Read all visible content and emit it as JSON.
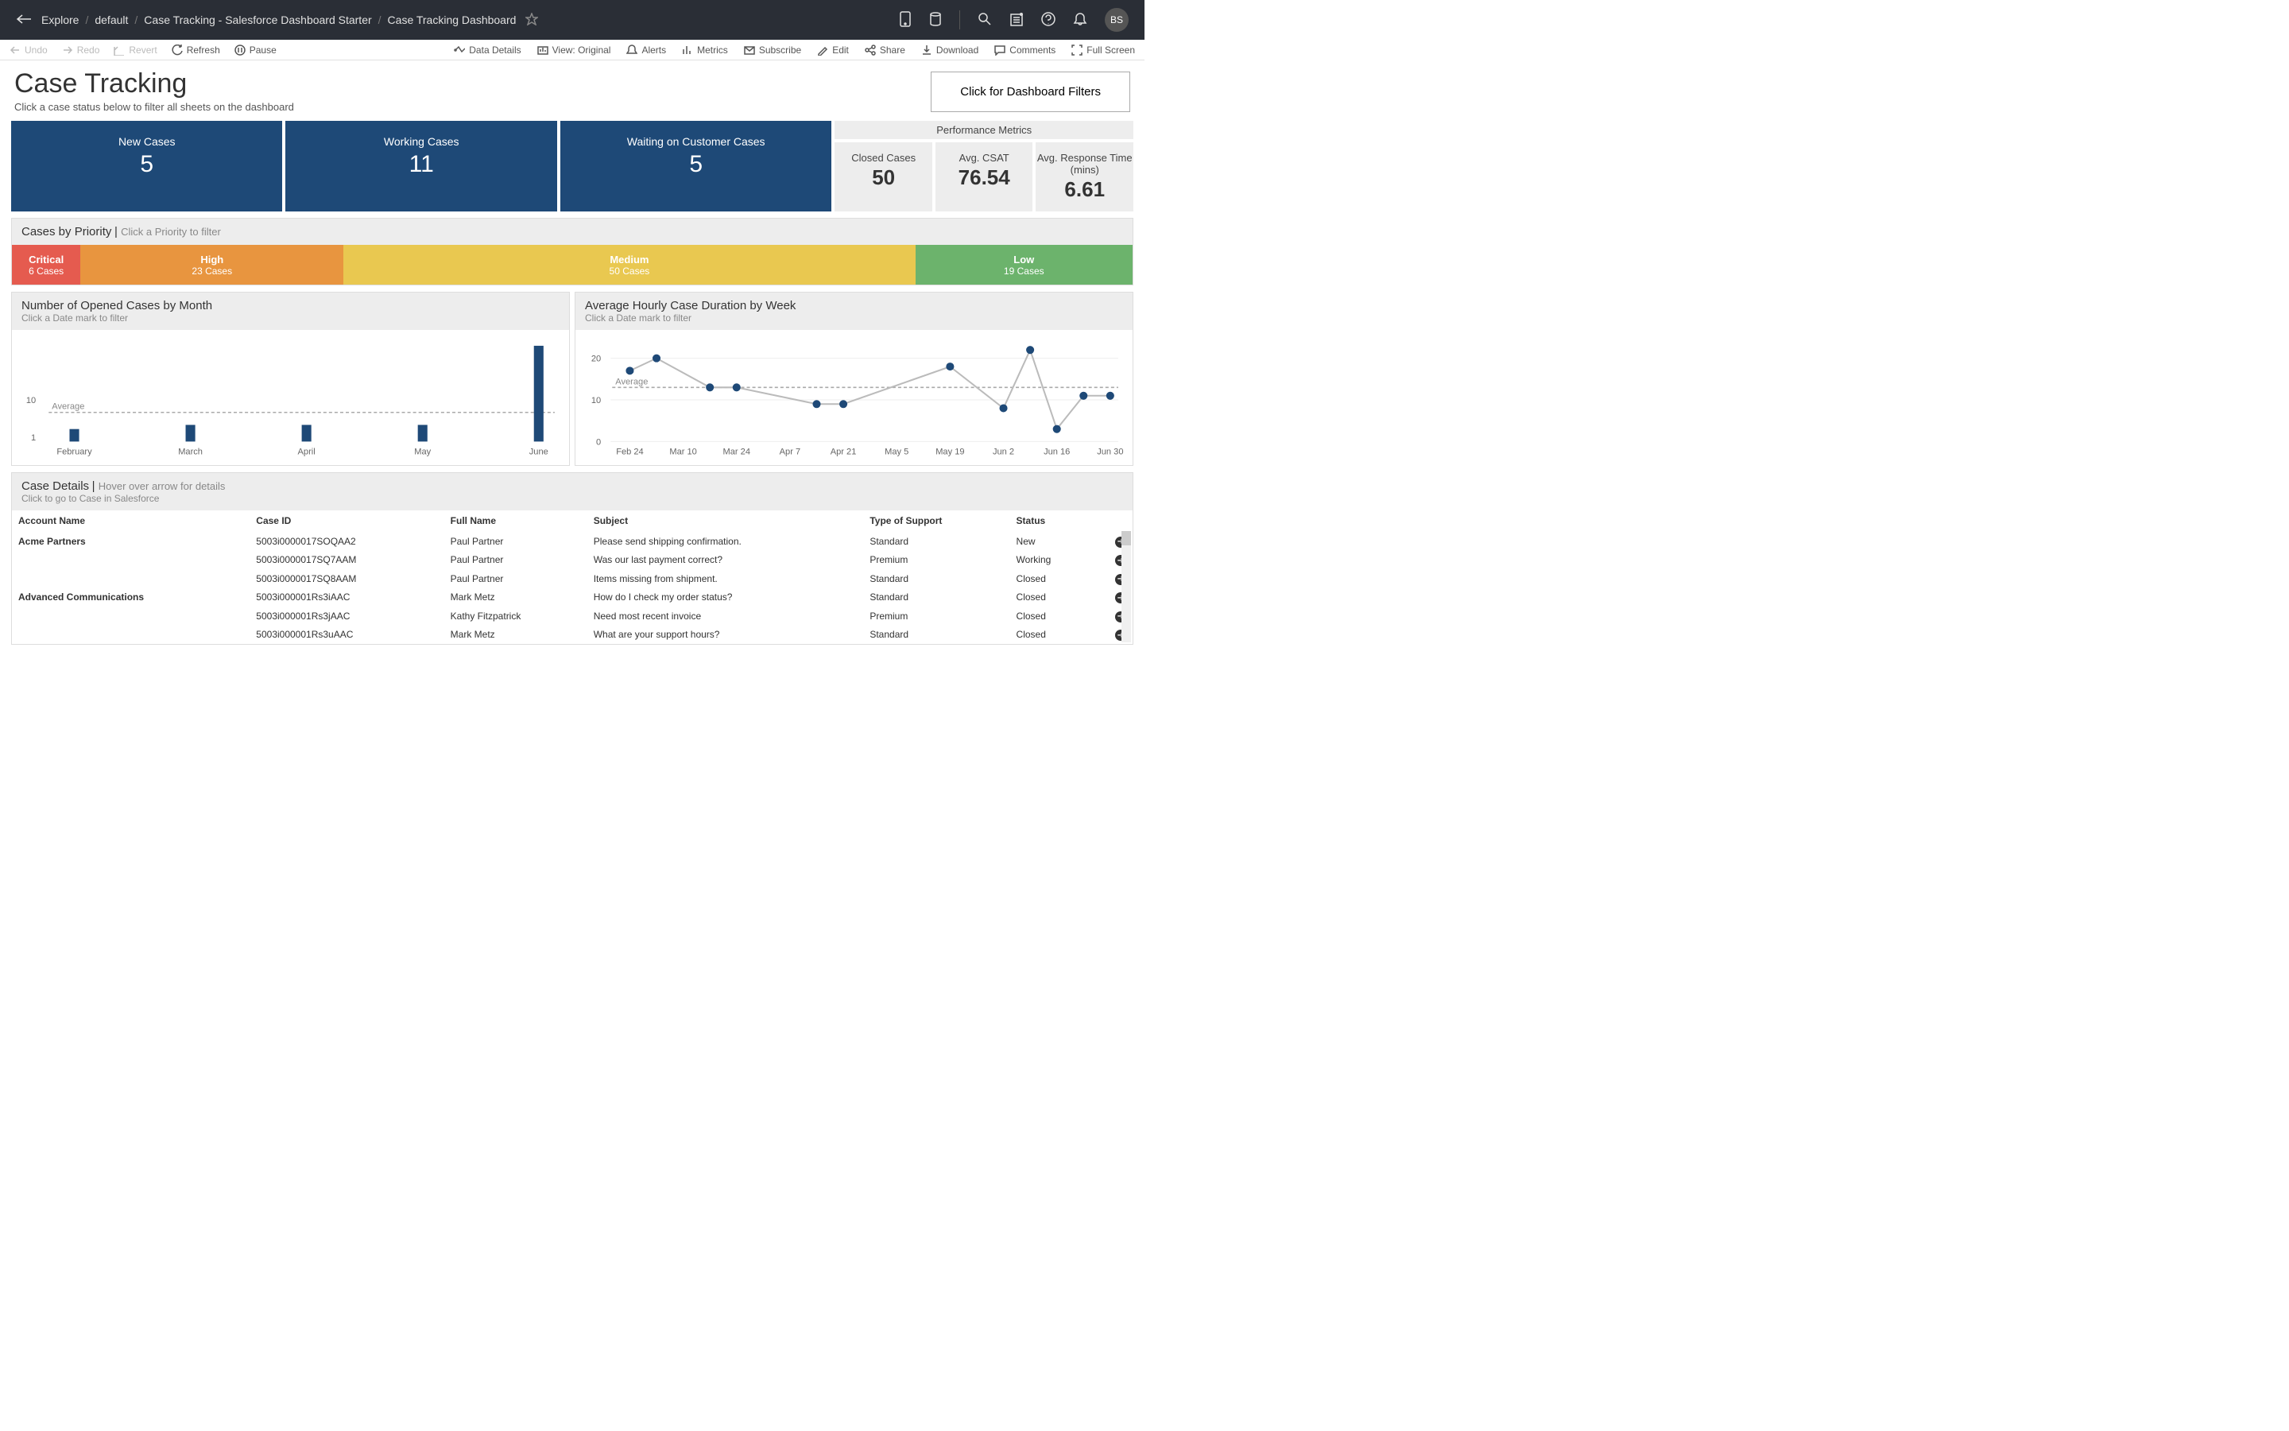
{
  "breadcrumb": {
    "items": [
      "Explore",
      "default",
      "Case Tracking - Salesforce Dashboard Starter",
      "Case Tracking Dashboard"
    ]
  },
  "avatar": "BS",
  "toolbar": {
    "undo": "Undo",
    "redo": "Redo",
    "revert": "Revert",
    "refresh": "Refresh",
    "pause": "Pause",
    "data_details": "Data Details",
    "view": "View: Original",
    "alerts": "Alerts",
    "metrics": "Metrics",
    "subscribe": "Subscribe",
    "edit": "Edit",
    "share": "Share",
    "download": "Download",
    "comments": "Comments",
    "fullscreen": "Full Screen"
  },
  "header": {
    "title": "Case Tracking",
    "subtitle": "Click a case status below to filter all sheets on the dashboard",
    "filter_button": "Click for Dashboard Filters"
  },
  "status_cards": [
    {
      "label": "New Cases",
      "value": "5"
    },
    {
      "label": "Working Cases",
      "value": "11"
    },
    {
      "label": "Waiting on Customer Cases",
      "value": "5"
    }
  ],
  "perf": {
    "header": "Performance Metrics",
    "cards": [
      {
        "label": "Closed Cases",
        "value": "50"
      },
      {
        "label": "Avg. CSAT",
        "value": "76.54"
      },
      {
        "label": "Avg. Response Time (mins)",
        "value": "6.61"
      }
    ]
  },
  "priority": {
    "title": "Cases by Priority",
    "hint": "Click a Priority to filter",
    "segments": [
      {
        "label": "Critical",
        "count": "6 Cases",
        "color": "#e55b4f",
        "width": 6
      },
      {
        "label": "High",
        "count": "23 Cases",
        "color": "#e8953f",
        "width": 23
      },
      {
        "label": "Medium",
        "count": "50 Cases",
        "color": "#e9c850",
        "width": 50
      },
      {
        "label": "Low",
        "count": "19 Cases",
        "color": "#6cb36c",
        "width": 19
      }
    ]
  },
  "chart1": {
    "title": "Number of Opened Cases by Month",
    "hint": "Click a Date mark to filter",
    "average_label": "Average"
  },
  "chart2": {
    "title": "Average Hourly Case Duration by Week",
    "hint": "Click a Date mark to filter",
    "average_label": "Average"
  },
  "chart_data": [
    {
      "type": "bar",
      "title": "Number of Opened Cases by Month",
      "xlabel": "",
      "ylabel": "",
      "ylim": [
        1,
        40
      ],
      "yticks": [
        1,
        10
      ],
      "average": 7,
      "categories": [
        "February",
        "March",
        "April",
        "May",
        "June"
      ],
      "values": [
        3,
        4,
        4,
        4,
        23
      ]
    },
    {
      "type": "line",
      "title": "Average Hourly Case Duration by Week",
      "xlabel": "",
      "ylabel": "",
      "ylim": [
        0,
        25
      ],
      "yticks": [
        0,
        10,
        20
      ],
      "average": 13,
      "categories": [
        "Feb 24",
        "Mar 10",
        "Mar 24",
        "Apr 7",
        "Apr 21",
        "May 5",
        "May 19",
        "Jun 2",
        "Jun 16",
        "Jun 30"
      ],
      "x_dates": [
        "Feb 24",
        "Mar 3",
        "Mar 17",
        "Mar 24",
        "Apr 14",
        "Apr 21",
        "May 19",
        "Jun 2",
        "Jun 9",
        "Jun 16",
        "Jun 23",
        "Jun 30"
      ],
      "values": [
        17,
        20,
        13,
        13,
        9,
        9,
        18,
        8,
        22,
        3,
        11,
        11
      ]
    }
  ],
  "details": {
    "title": "Case Details",
    "hint": "Hover over arrow for details",
    "sub": "Click to go to Case in Salesforce",
    "columns": [
      "Account Name",
      "Case ID",
      "Full Name",
      "Subject",
      "Type of Support",
      "Status"
    ],
    "rows": [
      {
        "account": "Acme Partners",
        "case_id": "5003i0000017SOQAA2",
        "name": "Paul Partner",
        "subject": "Please send shipping confirmation.",
        "support": "Standard",
        "status": "New"
      },
      {
        "account": "",
        "case_id": "5003i0000017SQ7AAM",
        "name": "Paul Partner",
        "subject": "Was our last payment correct?",
        "support": "Premium",
        "status": "Working"
      },
      {
        "account": "",
        "case_id": "5003i0000017SQ8AAM",
        "name": "Paul Partner",
        "subject": "Items missing from shipment.",
        "support": "Standard",
        "status": "Closed"
      },
      {
        "account": "Advanced Communications",
        "case_id": "5003i000001Rs3iAAC",
        "name": "Mark Metz",
        "subject": "How do I check my order status?",
        "support": "Standard",
        "status": "Closed"
      },
      {
        "account": "",
        "case_id": "5003i000001Rs3jAAC",
        "name": "Kathy Fitzpatrick",
        "subject": "Need most recent invoice",
        "support": "Premium",
        "status": "Closed"
      },
      {
        "account": "",
        "case_id": "5003i000001Rs3uAAC",
        "name": "Mark Metz",
        "subject": "What are your support hours?",
        "support": "Standard",
        "status": "Closed"
      }
    ]
  }
}
